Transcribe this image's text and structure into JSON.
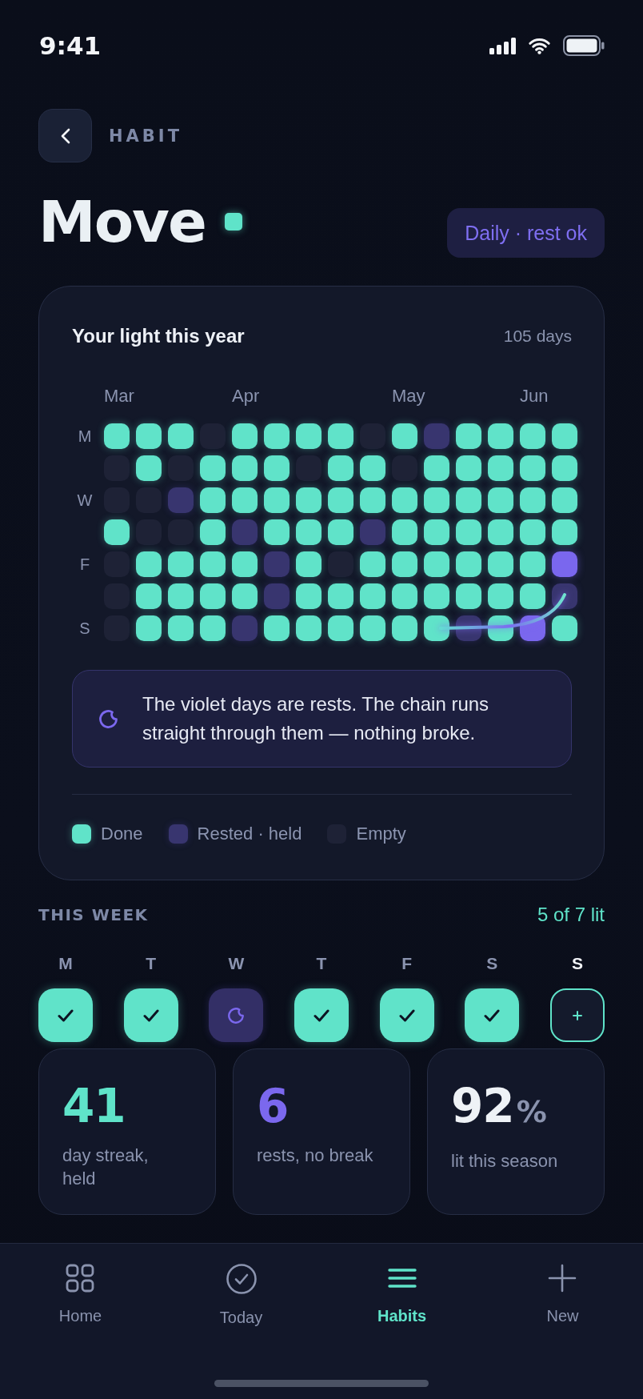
{
  "status_bar": {
    "time": "9:41"
  },
  "header": {
    "section": "HABIT"
  },
  "habit": {
    "name": "Move",
    "schedule": "Daily · rest ok"
  },
  "year_card": {
    "title": "Your light this year",
    "count": "105 days",
    "weekday_labels": [
      "M",
      "W",
      "F",
      "S"
    ],
    "weeks": [
      {
        "month": "Mar",
        "days": [
          {
            "kind": "done"
          },
          {
            "kind": "empty"
          },
          {
            "kind": "empty"
          },
          {
            "kind": "done"
          },
          {
            "kind": "empty"
          },
          {
            "kind": "empty"
          },
          {
            "kind": "empty"
          }
        ]
      },
      {
        "days": [
          {
            "kind": "done"
          },
          {
            "kind": "done"
          },
          {
            "kind": "empty"
          },
          {
            "kind": "empty"
          },
          {
            "kind": "done"
          },
          {
            "kind": "done"
          },
          {
            "kind": "done"
          }
        ]
      },
      {
        "days": [
          {
            "kind": "done"
          },
          {
            "kind": "empty"
          },
          {
            "kind": "rest"
          },
          {
            "kind": "empty"
          },
          {
            "kind": "done"
          },
          {
            "kind": "done"
          },
          {
            "kind": "done"
          }
        ]
      },
      {
        "days": [
          {
            "kind": "empty"
          },
          {
            "kind": "done"
          },
          {
            "kind": "done"
          },
          {
            "kind": "done"
          },
          {
            "kind": "done"
          },
          {
            "kind": "done"
          },
          {
            "kind": "done"
          }
        ]
      },
      {
        "month": "Apr",
        "days": [
          {
            "kind": "done"
          },
          {
            "kind": "done"
          },
          {
            "kind": "done"
          },
          {
            "kind": "rest"
          },
          {
            "kind": "done"
          },
          {
            "kind": "done"
          },
          {
            "kind": "rest"
          }
        ]
      },
      {
        "days": [
          {
            "kind": "done"
          },
          {
            "kind": "done"
          },
          {
            "kind": "done"
          },
          {
            "kind": "done"
          },
          {
            "kind": "rest"
          },
          {
            "kind": "rest"
          },
          {
            "kind": "done"
          }
        ]
      },
      {
        "days": [
          {
            "kind": "done"
          },
          {
            "kind": "empty"
          },
          {
            "kind": "done"
          },
          {
            "kind": "done"
          },
          {
            "kind": "done"
          },
          {
            "kind": "done"
          },
          {
            "kind": "done"
          }
        ]
      },
      {
        "days": [
          {
            "kind": "done"
          },
          {
            "kind": "done"
          },
          {
            "kind": "done"
          },
          {
            "kind": "done"
          },
          {
            "kind": "empty"
          },
          {
            "kind": "done"
          },
          {
            "kind": "done"
          }
        ]
      },
      {
        "days": [
          {
            "kind": "empty"
          },
          {
            "kind": "done"
          },
          {
            "kind": "done"
          },
          {
            "kind": "rest"
          },
          {
            "kind": "done"
          },
          {
            "kind": "done"
          },
          {
            "kind": "done"
          }
        ]
      },
      {
        "month": "May",
        "days": [
          {
            "kind": "done"
          },
          {
            "kind": "empty"
          },
          {
            "kind": "done"
          },
          {
            "kind": "done"
          },
          {
            "kind": "done"
          },
          {
            "kind": "done"
          },
          {
            "kind": "done"
          }
        ]
      },
      {
        "days": [
          {
            "kind": "rest"
          },
          {
            "kind": "done"
          },
          {
            "kind": "done"
          },
          {
            "kind": "done"
          },
          {
            "kind": "done"
          },
          {
            "kind": "done"
          },
          {
            "kind": "done"
          }
        ]
      },
      {
        "days": [
          {
            "kind": "done"
          },
          {
            "kind": "done"
          },
          {
            "kind": "done"
          },
          {
            "kind": "done"
          },
          {
            "kind": "done"
          },
          {
            "kind": "done"
          },
          {
            "kind": "rest"
          }
        ]
      },
      {
        "days": [
          {
            "kind": "done"
          },
          {
            "kind": "done"
          },
          {
            "kind": "done"
          },
          {
            "kind": "done"
          },
          {
            "kind": "done"
          },
          {
            "kind": "done"
          },
          {
            "kind": "done"
          }
        ]
      },
      {
        "month": "Jun",
        "days": [
          {
            "kind": "done"
          },
          {
            "kind": "done"
          },
          {
            "kind": "done"
          },
          {
            "kind": "done"
          },
          {
            "kind": "done"
          },
          {
            "kind": "done"
          },
          {
            "kind": "accent"
          }
        ]
      },
      {
        "days": [
          {
            "kind": "done"
          },
          {
            "kind": "done"
          },
          {
            "kind": "done"
          },
          {
            "kind": "done"
          },
          {
            "kind": "accent"
          },
          {
            "kind": "rest"
          },
          {
            "kind": "done"
          }
        ]
      }
    ],
    "note": "The violet days are rests. The chain runs straight through them — nothing broke.",
    "legend": [
      {
        "label": "Done",
        "kind": "done"
      },
      {
        "label": "Rested · held",
        "kind": "rest"
      },
      {
        "label": "Empty",
        "kind": "empty"
      }
    ]
  },
  "this_week": {
    "title": "THIS WEEK",
    "summary": "5 of 7 lit",
    "days": [
      {
        "label": "M",
        "kind": "done",
        "selected": false
      },
      {
        "label": "T",
        "kind": "done",
        "selected": false
      },
      {
        "label": "W",
        "kind": "rest",
        "selected": false
      },
      {
        "label": "T",
        "kind": "done",
        "selected": false
      },
      {
        "label": "F",
        "kind": "done",
        "selected": false
      },
      {
        "label": "S",
        "kind": "done",
        "selected": false
      },
      {
        "label": "S",
        "kind": "open",
        "selected": true
      }
    ]
  },
  "stats": [
    {
      "value": "41",
      "label": "day streak, held",
      "color": "#5fe3c9"
    },
    {
      "value": "6",
      "label": "rests, no break",
      "color": "#7b68ee"
    },
    {
      "value": "92",
      "unit": "%",
      "label": "lit this season",
      "color": "#eef2f6"
    }
  ],
  "tab_bar": {
    "tabs": [
      {
        "label": "Home",
        "kind": "grid",
        "selected": false
      },
      {
        "label": "Today",
        "kind": "check",
        "selected": false
      },
      {
        "label": "Habits",
        "kind": "list",
        "selected": true
      },
      {
        "label": "New",
        "kind": "plus",
        "selected": false
      }
    ]
  }
}
